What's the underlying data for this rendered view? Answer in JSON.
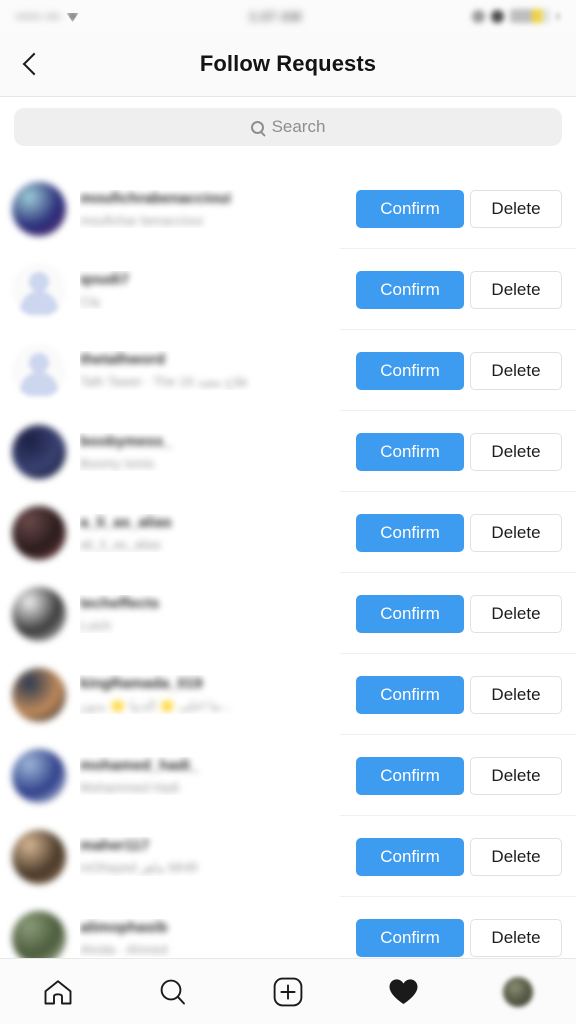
{
  "status_bar": {
    "carrier": "••••• •••",
    "time": "1:07 AM",
    "battery": "15%"
  },
  "header": {
    "title": "Follow Requests",
    "back_icon": "chevron-left-icon"
  },
  "search": {
    "placeholder": "Search",
    "value": "",
    "icon": "search-icon"
  },
  "actions": {
    "confirm_label": "Confirm",
    "delete_label": "Delete"
  },
  "colors": {
    "confirm_blue": "#3d9bf0",
    "delete_border": "#e0e0e0",
    "search_bg": "#efefef",
    "text_primary": "#262626",
    "text_secondary": "#9a9a9a"
  },
  "requests": [
    {
      "username": "moufichrabenaccioui",
      "fullname": "moufichar benaccioui",
      "avatar_type": "photo",
      "avatar_colors": [
        "#9fd0d8",
        "#2b2f7a",
        "#5b2a6e"
      ]
    },
    {
      "username": "qoudi7",
      "fullname": "Ciq",
      "avatar_type": "default",
      "avatar_colors": [
        "#ccd6ee"
      ]
    },
    {
      "username": "thetalhword",
      "fullname": "Talh Tawer · The فلاح معيد 16",
      "avatar_type": "default",
      "avatar_colors": [
        "#ccd6ee"
      ]
    },
    {
      "username": "boobymess_",
      "fullname": "Boomy Ismis",
      "avatar_type": "photo",
      "avatar_colors": [
        "#1b2044",
        "#3a4272",
        "#0d1028"
      ]
    },
    {
      "username": "a_li_as_alias",
      "fullname": "ali_li_as_alias",
      "avatar_type": "photo",
      "avatar_colors": [
        "#6b4a4a",
        "#2a1a1a",
        "#8a5050"
      ]
    },
    {
      "username": "techeffects",
      "fullname": "Luich",
      "avatar_type": "photo",
      "avatar_colors": [
        "#f2f2f2",
        "#3a3a3a",
        "#cfcfcf"
      ]
    },
    {
      "username": "kingRamada_019",
      "fullname": "ما احلى 🌟 الدنيا 🌟 بدون...",
      "avatar_type": "photo",
      "avatar_colors": [
        "#2a3a52",
        "#c08a5a",
        "#16202e"
      ]
    },
    {
      "username": "mohamed_hadi_",
      "fullname": "Mohammed Hadi",
      "avatar_type": "photo",
      "avatar_colors": [
        "#9fb8d8",
        "#2f3f8a",
        "#d8dfe8"
      ]
    },
    {
      "username": "maher117",
      "fullname": "mOhayed ماهر MHR",
      "avatar_type": "photo",
      "avatar_colors": [
        "#d8b894",
        "#4a3a2a",
        "#8a6a4a"
      ]
    },
    {
      "username": "alimophasib",
      "fullname": "Alvida · Ahmed",
      "avatar_type": "photo",
      "avatar_colors": [
        "#8a9c7a",
        "#4a5a3a",
        "#c8d0b8"
      ]
    }
  ],
  "tabbar": {
    "items": [
      {
        "name": "home-icon",
        "label": "Home",
        "active": false
      },
      {
        "name": "search-icon",
        "label": "Search",
        "active": false
      },
      {
        "name": "add-post-icon",
        "label": "New Post",
        "active": false
      },
      {
        "name": "heart-icon",
        "label": "Activity",
        "active": true
      },
      {
        "name": "profile-avatar",
        "label": "Profile",
        "active": false
      }
    ]
  }
}
